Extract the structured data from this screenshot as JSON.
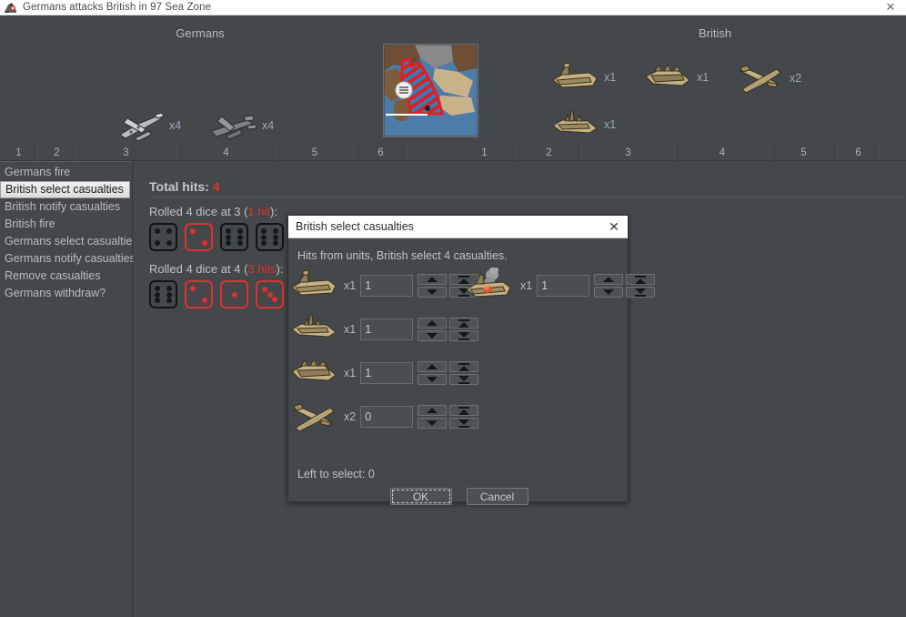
{
  "window": {
    "title": "Germans attacks British in 97 Sea Zone",
    "icon": "battle-icon",
    "close_label": "✕"
  },
  "battle": {
    "attacker_header": "Germans",
    "defender_header": "British",
    "territory_thumb_name": "97-sea-zone-thumbnail",
    "attacker_units": [
      {
        "icon": "fighter-plane-icon",
        "count": "x4"
      },
      {
        "icon": "bomber-plane-icon",
        "count": "x4"
      }
    ],
    "defender_units": [
      {
        "icon": "transport-ship-icon",
        "count": "x1"
      },
      {
        "icon": "battleship-icon",
        "count": "x1"
      },
      {
        "icon": "fighter-plane-icon",
        "count": "x2"
      },
      {
        "icon": "destroyer-ship-icon",
        "count": "x1"
      }
    ],
    "scale_left": [
      "1",
      "2",
      "3",
      "4",
      "5",
      "6"
    ],
    "scale_right": [
      "1",
      "2",
      "3",
      "4",
      "5",
      "6"
    ]
  },
  "steps": {
    "items": [
      {
        "label": "Germans fire",
        "selected": false
      },
      {
        "label": "British select casualties",
        "selected": true
      },
      {
        "label": "British notify casualties",
        "selected": false
      },
      {
        "label": "British fire",
        "selected": false
      },
      {
        "label": "Germans select casualties",
        "selected": false
      },
      {
        "label": "Germans notify casualties",
        "selected": false
      },
      {
        "label": "Remove casualties",
        "selected": false
      },
      {
        "label": "Germans withdraw?",
        "selected": false
      }
    ]
  },
  "results": {
    "total_hits_label": "Total hits:",
    "total_hits_value": "4",
    "rolls": [
      {
        "label_prefix": "Rolled 4 dice at 3 (",
        "hits_text": "1 hit",
        "label_suffix": "):",
        "dice": [
          {
            "value": 4,
            "hit": false
          },
          {
            "value": 2,
            "hit": true
          },
          {
            "value": 6,
            "hit": false
          },
          {
            "value": 6,
            "hit": false
          }
        ]
      },
      {
        "label_prefix": "Rolled 4 dice at 4 (",
        "hits_text": "3 hits",
        "label_suffix": "):",
        "dice": [
          {
            "value": 6,
            "hit": false
          },
          {
            "value": 2,
            "hit": true
          },
          {
            "value": 1,
            "hit": true
          },
          {
            "value": 3,
            "hit": true
          }
        ]
      }
    ]
  },
  "dialog": {
    "title": "British select casualties",
    "close_label": "✕",
    "prompt": "Hits from units,  British select 4 casualties.",
    "rows": [
      {
        "icon": "transport-ship-icon",
        "count": "x1",
        "value": "1"
      },
      {
        "icon": "damaged-ship-icon",
        "count": "x1",
        "value": "1"
      },
      {
        "icon": "destroyer-ship-icon",
        "count": "x1",
        "value": "1"
      },
      {
        "icon": "battleship-icon",
        "count": "x1",
        "value": "1"
      },
      {
        "icon": "fighter-plane-icon",
        "count": "x2",
        "value": "0"
      }
    ],
    "left_to_select": "Left to select: 0",
    "ok_label": "OK",
    "cancel_label": "Cancel"
  },
  "colors": {
    "background": "#45484a",
    "hit_red": "#e03030",
    "text": "#bfc2c5",
    "count_blue": "#9aa7bb"
  }
}
